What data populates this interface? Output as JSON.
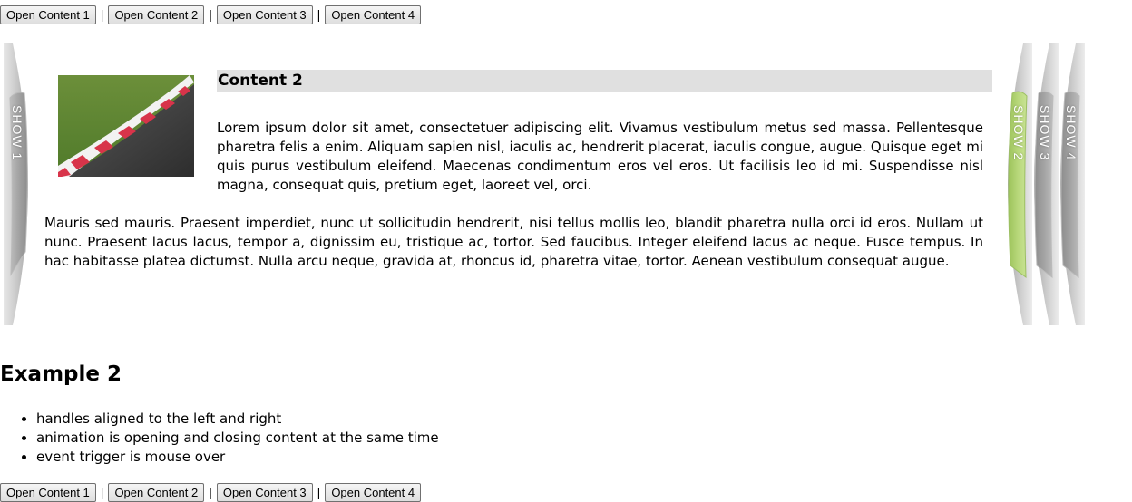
{
  "top_buttons": {
    "b1": "Open Content 1",
    "b2": "Open Content 2",
    "b3": "Open Content 3",
    "b4": "Open Content 4",
    "sep": "|"
  },
  "tabs": {
    "t1": "SHOW 1",
    "t2": "SHOW 2",
    "t3": "SHOW 3",
    "t4": "SHOW 4",
    "active": "SHOW 2",
    "active_color": "#b7d77a",
    "inactive_color": "#9a9a9a"
  },
  "content": {
    "title": "Content 2",
    "image_icon": "race-track-curb-image",
    "paragraph1": "Lorem ipsum dolor sit amet, consectetuer adipiscing elit. Vivamus vestibulum metus sed massa. Pellentesque pharetra felis a enim. Aliquam sapien nisl, iaculis ac, hendrerit placerat, iaculis congue, augue. Quisque eget mi quis purus vestibulum eleifend. Maecenas condimentum eros vel eros. Ut facilisis leo id mi. Suspendisse nisl magna, consequat quis, pretium eget, laoreet vel, orci.",
    "paragraph2": "Mauris sed mauris. Praesent imperdiet, nunc ut sollicitudin hendrerit, nisi tellus mollis leo, blandit pharetra nulla orci id eros. Nullam ut nunc. Praesent lacus lacus, tempor a, dignissim eu, tristique ac, tortor. Sed faucibus. Integer eleifend lacus ac neque. Fusce tempus. In hac habitasse platea dictumst. Nulla arcu neque, gravida at, rhoncus id, pharetra vitae, tortor. Aenean vestibulum consequat augue."
  },
  "example2": {
    "title": "Example 2",
    "bullets": [
      "handles aligned to the left and right",
      "animation is opening and closing content at the same time",
      "event trigger is mouse over"
    ]
  },
  "bottom_buttons": {
    "b1": "Open Content 1",
    "b2": "Open Content 2",
    "b3": "Open Content 3",
    "b4": "Open Content 4",
    "sep": "|"
  }
}
